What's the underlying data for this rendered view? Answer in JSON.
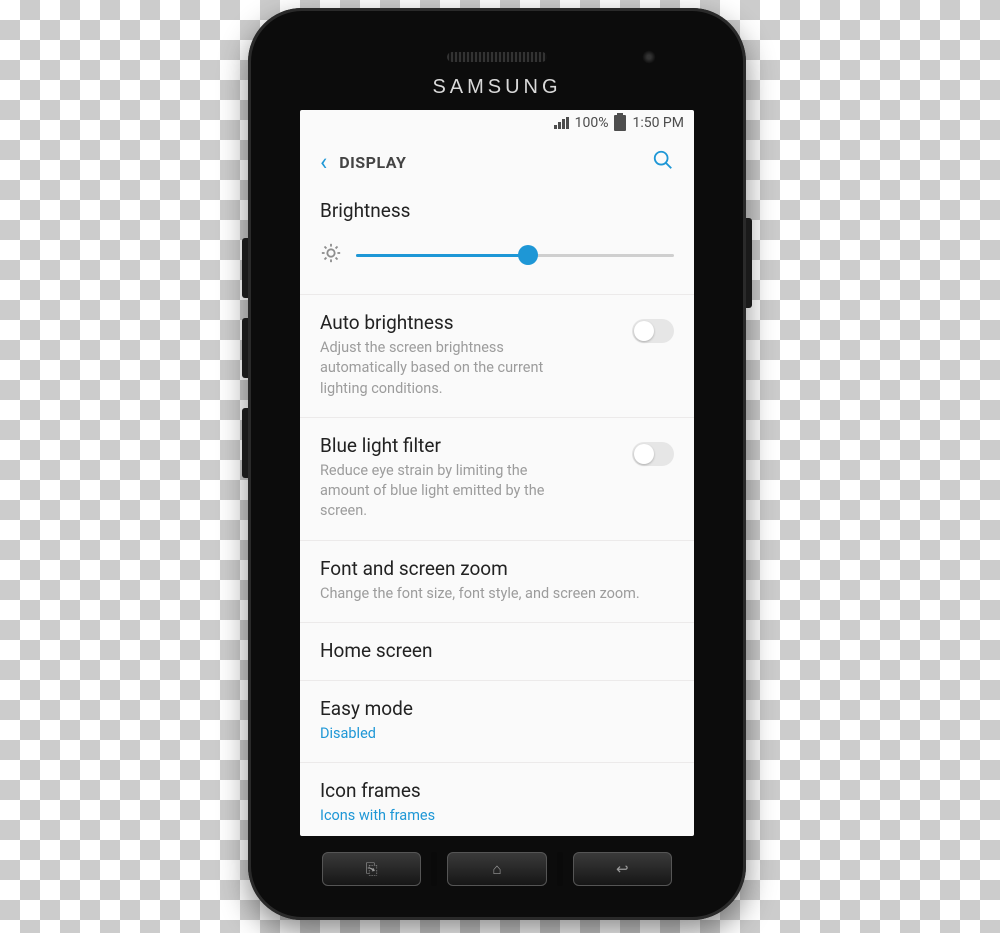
{
  "device_brand": "SAMSUNG",
  "status": {
    "battery_pct": "100%",
    "time": "1:50 PM"
  },
  "header": {
    "title": "DISPLAY"
  },
  "brightness": {
    "label": "Brightness",
    "slider_pct": 54
  },
  "items": {
    "auto": {
      "label": "Auto brightness",
      "sub": "Adjust the screen brightness automatically based on the current lighting conditions.",
      "on": false
    },
    "blue": {
      "label": "Blue light filter",
      "sub": "Reduce eye strain by limiting the amount of blue light emitted by the screen.",
      "on": false
    },
    "font": {
      "label": "Font and screen zoom",
      "sub": "Change the font size, font style, and screen zoom."
    },
    "home": {
      "label": "Home screen"
    },
    "easy": {
      "label": "Easy mode",
      "value": "Disabled"
    },
    "iconf": {
      "label": "Icon frames",
      "value": "Icons with frames"
    }
  }
}
